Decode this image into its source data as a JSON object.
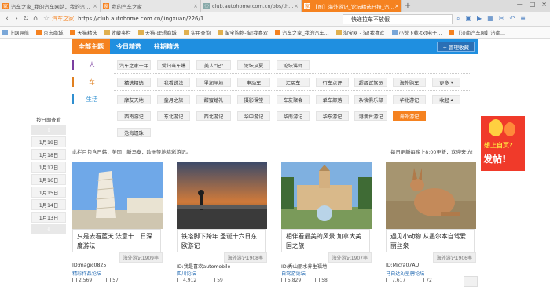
{
  "browser": {
    "tabs": [
      {
        "label": "汽车之家_我的汽车网站，我的汽车之家",
        "active": false
      },
      {
        "label": "我的汽车之家",
        "active": false
      },
      {
        "label": "club.autohome.com.cn/bbs/thread",
        "active": false
      },
      {
        "label": "【图】海外游记_论坛精选日报_汽车之家",
        "active": true
      }
    ],
    "site_name": "汽车之家",
    "url": "https://club.autohome.com.cn/jingxuan/226/1",
    "search_value": "快递拉车不放假",
    "bookmarks": [
      "上网导航",
      "京东商城",
      "天猫精选",
      "收藏夹栏",
      "天猫-理想商城",
      "实用查询",
      "淘宝购物-淘!我喜欢",
      "汽车之家_我的汽车...",
      "淘宝网 - 淘!我喜欢",
      "小说下载-txt电子...",
      "【济南汽车网】济南..."
    ]
  },
  "nav": {
    "tabs": [
      "全部主题",
      "今日精选",
      "往期精选"
    ],
    "active_tab": "全部主题",
    "favorite_button": "+ 管理收藏"
  },
  "categories": {
    "row1_label": "人",
    "row1": [
      "汽车之家十年",
      "爱归当车爆",
      "美人\"记\"",
      "论坛从夏",
      "论坛讲师"
    ],
    "row2_label": "车",
    "row2": [
      "精选精选",
      "我看说法",
      "里润闸地",
      "电动车",
      "汇买车",
      "行车点评",
      "超级试驾员",
      "海外购车",
      "更多"
    ],
    "row3_label": "生活",
    "row3a": [
      "摩友天地",
      "童月之旅",
      "甜蜜婚礼",
      "摄影课堂",
      "车友聚会",
      "单车部落",
      "杂谈俱乐部",
      "华北游记",
      "收起"
    ],
    "row3b": [
      "西南游记",
      "东北游记",
      "西北游记",
      "华中游记",
      "华南游记",
      "华东游记",
      "港澳台游记",
      "海外游记"
    ],
    "row3c": [
      "沧海遗珠"
    ],
    "selected": "海外游记"
  },
  "dates": {
    "heading": "按日期查看",
    "items": [
      "1月19日",
      "1月18日",
      "1月17日",
      "1月16日",
      "1月15日",
      "1月14日",
      "1月13日"
    ]
  },
  "breadcrumb": "此栏目包含日韩，美国，新马泰，欧洲等地精彩游记。",
  "notice": "每日更新每晚上8:00更新，欢迎来访!",
  "posts": [
    {
      "title": "只是去看蓝天 法意十二日深度游法",
      "tag": "海外游记1909率",
      "uid": "ID:magic0825",
      "forum": "精彩作品论坛",
      "views": "2,569",
      "replies": "57"
    },
    {
      "title": "铁塔脚下跨年 圣诞十六日东欧游记",
      "tag": "海外游记1908率",
      "uid": "ID:我是喜欢automobile",
      "forum": "四川论坛",
      "views": "4,912",
      "replies": "59"
    },
    {
      "title": "相伴看最美的风景 加拿大美国之旅",
      "tag": "海外游记1907率",
      "uid": "ID:秀山丽水养生福地",
      "forum": "自驾游论坛",
      "views": "5,829",
      "replies": "58"
    },
    {
      "title": "遇见小动物 从墨尔本自驾爱丽丝泉",
      "tag": "海外游记1906率",
      "uid": "ID:Micra07AU",
      "forum": "马自达3/星骋论坛",
      "views": "7,617",
      "replies": "72"
    }
  ],
  "ad": {
    "line1": "想上自页?",
    "line2": "发帖!"
  },
  "colors": {
    "accent": "#f58220",
    "nav_blue": "#1f8fe0"
  }
}
